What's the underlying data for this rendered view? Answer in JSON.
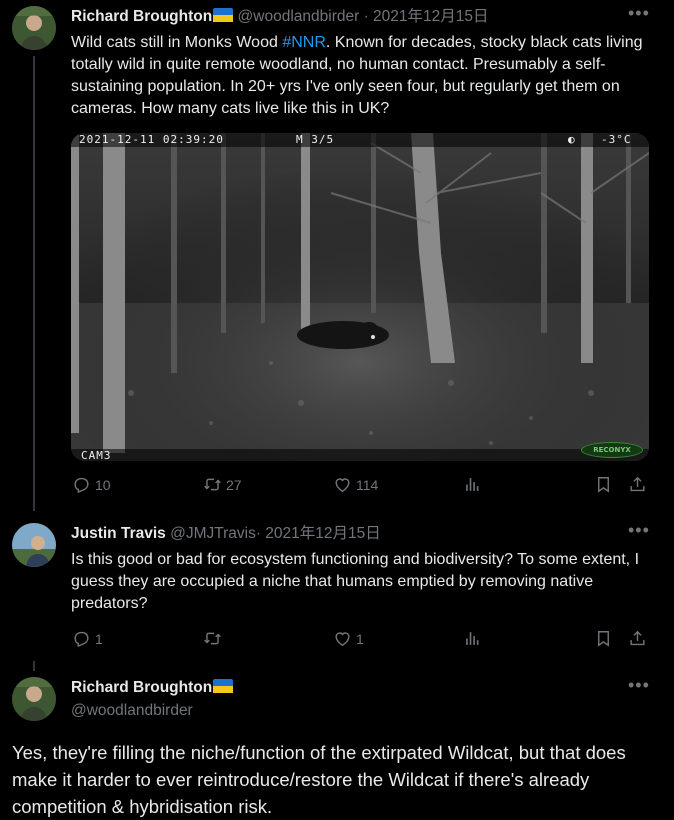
{
  "tweets": [
    {
      "author": "Richard Broughton",
      "handle": "@woodlandbirder",
      "date": "· 2021年12月15日",
      "text_before": "Wild cats still in Monks Wood ",
      "hashtag": "#NNR",
      "text_after": ". Known for decades, stocky black cats living totally wild in quite remote woodland, no human contact. Presumably a self-sustaining population. In 20+ yrs I've only seen four, but regularly get them on cameras. How many cats live like this in UK?",
      "media": {
        "timestamp": "2021-12-11 02:39:20",
        "mode": "M 3/5",
        "moon": "◐",
        "temperature": "-3°C",
        "camera": "CAM3",
        "brand": "RECONYX"
      },
      "replies": "10",
      "reposts": "27",
      "likes": "114"
    },
    {
      "author": "Justin Travis",
      "handle": "@JMJTravis",
      "date": "· 2021年12月15日",
      "text": "Is this good or bad for ecosystem functioning and biodiversity? To some extent, I guess they are occupied a niche that humans emptied by removing native predators?",
      "replies": "1",
      "reposts": "",
      "likes": "1"
    },
    {
      "author": "Richard Broughton",
      "handle": "@woodlandbirder",
      "text": "Yes, they're filling the niche/function of the extirpated Wildcat, but that does make it harder to ever reintroduce/restore the Wildcat if there's already competition & hybridisation risk."
    }
  ],
  "icons": {
    "more": "more-icon",
    "reply": "reply-icon",
    "repost": "repost-icon",
    "like": "like-icon",
    "views": "views-icon",
    "bookmark": "bookmark-icon",
    "share": "share-icon",
    "flag": "ukraine-flag-icon"
  },
  "colors": {
    "link": "#1d9bf0",
    "muted": "#71767b",
    "text": "#e7e9ea",
    "background": "#000000"
  }
}
